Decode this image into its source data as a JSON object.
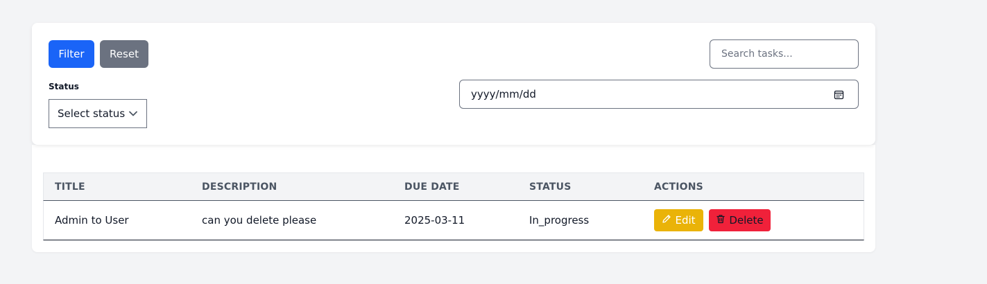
{
  "filters": {
    "filter_label": "Filter",
    "reset_label": "Reset",
    "status_label": "Status",
    "status_selected": "Select status",
    "search_placeholder": "Search tasks...",
    "date_placeholder": "yyyy/mm/dd"
  },
  "table": {
    "headers": [
      "TITLE",
      "DESCRIPTION",
      "DUE DATE",
      "STATUS",
      "ACTIONS"
    ],
    "rows": [
      {
        "title": "Admin to User",
        "description": "can you delete please",
        "due_date": "2025-03-11",
        "status": "In_progress",
        "edit_label": "Edit",
        "delete_label": "Delete"
      }
    ]
  },
  "icons": {
    "select": "chevron-down-icon",
    "date": "calendar-icon",
    "edit": "pencil-icon",
    "delete": "trash-icon"
  },
  "colors": {
    "filter_button": "#1a64f7",
    "reset_button": "#6b7280",
    "edit_button": "#eab308",
    "delete_button": "#f0213a"
  }
}
